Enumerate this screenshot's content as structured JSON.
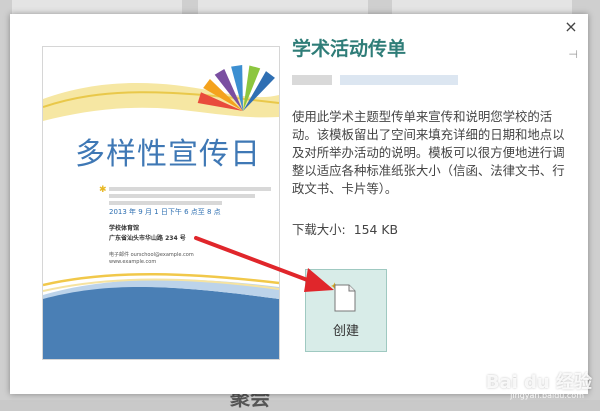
{
  "dialog": {
    "close_glyph": "×",
    "pin_glyph": "⊣"
  },
  "template": {
    "title": "学术活动传单",
    "description": "使用此学术主题型传单来宣传和说明您学校的活动。该模板留出了空间来填充详细的日期和地点以及对所举办活动的说明。模板可以很方便地进行调整以适应各种标准纸张大小（信函、法律文书、行政文书、卡片等）。",
    "size_label": "下载大小:",
    "size_value": "154 KB",
    "create_label": "创建"
  },
  "flyer": {
    "title": "多样性宣传日",
    "date": "2013 年 9 月 1 日下午 6 点至 8 点",
    "venue": "学校体育馆",
    "address": "广东省汕头市华山路 234 号",
    "email": "电子邮件 ourschool@example.com",
    "site": "www.example.com",
    "colors": [
      "#e94b3c",
      "#f4a21d",
      "#7a4fa1",
      "#3c8fd1",
      "#8cc63f",
      "#2f6fb3"
    ]
  },
  "background": {
    "partial_text": "聚会"
  },
  "watermark": {
    "text": "Bai du 经验",
    "sub": "jingyan.baidu.com"
  },
  "colors": {
    "accent": "#2f7d78",
    "arrow": "#e0262b",
    "create_bg": "#d8ece8"
  }
}
